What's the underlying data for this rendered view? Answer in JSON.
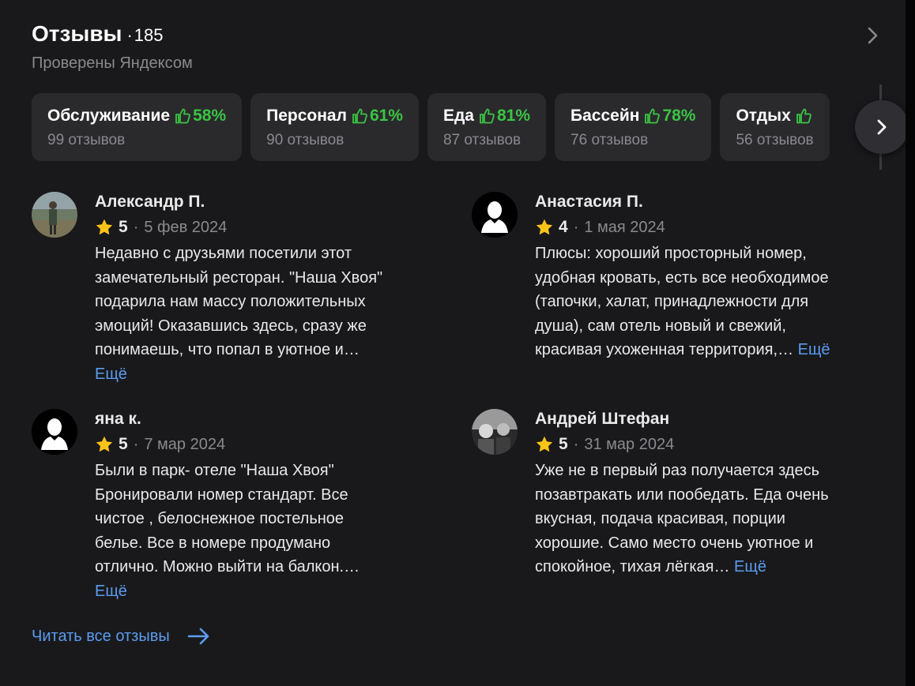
{
  "header": {
    "title": "Отзывы",
    "dot": "·",
    "count": "185",
    "subtitle": "Проверены Яндексом"
  },
  "aspects": [
    {
      "name": "Обслуживание",
      "percent": "58%",
      "reviews": "99 отзывов"
    },
    {
      "name": "Персонал",
      "percent": "61%",
      "reviews": "90 отзывов"
    },
    {
      "name": "Еда",
      "percent": "81%",
      "reviews": "87 отзывов"
    },
    {
      "name": "Бассейн",
      "percent": "78%",
      "reviews": "76 отзывов"
    },
    {
      "name": "Отдых",
      "percent": "",
      "reviews": "56 отзывов"
    }
  ],
  "reviews": [
    {
      "author": "Александр П.",
      "rating": "5",
      "date": "5 фев 2024",
      "lines": [
        "Недавно с друзьями посетили этот",
        "замечательный ресторан. \"Наша Хвоя\"",
        "подарила нам массу положительных",
        "эмоций! Оказавшись здесь, сразу же",
        "понимаешь, что попал в уютное и…"
      ],
      "tail": "",
      "more": "Ещё"
    },
    {
      "author": "Анастасия П.",
      "rating": "4",
      "date": "1 мая 2024",
      "lines": [
        "Плюсы: хороший просторный номер,",
        "удобная кровать, есть все необходимое",
        "(тапочки, халат, принадлежности для",
        "душа), сам отель новый и свежий,"
      ],
      "tail": "красивая ухоженная территория,…",
      "more": "Ещё"
    },
    {
      "author": "яна к.",
      "rating": "5",
      "date": "7 мар 2024",
      "lines": [
        "Были в парк- отеле \"Наша Хвоя\"",
        "Бронировали номер стандарт. Все",
        "чистое , белоснежное постельное",
        "белье. Все в номере продумано",
        "отлично. Можно выйти на балкон.…"
      ],
      "tail": "",
      "more": "Ещё"
    },
    {
      "author": "Андрей Штефан",
      "rating": "5",
      "date": "31 мар 2024",
      "lines": [
        "Уже не в первый раз получается здесь",
        "позавтракать или пообедать. Еда очень",
        "вкусная, подача красивая, порции",
        "хорошие. Само место очень уютное и"
      ],
      "tail": "спокойное, тихая лёгкая…",
      "more": "Ещё"
    }
  ],
  "read_all": "Читать все отзывы",
  "icons": {
    "header": "chevron-right-icon",
    "aspect": "thumb-up-icon",
    "rating": "star-icon",
    "read_all": "arrow-right-icon"
  },
  "colors": {
    "background": "#19191b",
    "chip": "#2a2a2d",
    "positive": "#3bc443",
    "link": "#5b9cf0",
    "star": "#fcc419",
    "secondary_text": "#8a8a8e"
  }
}
